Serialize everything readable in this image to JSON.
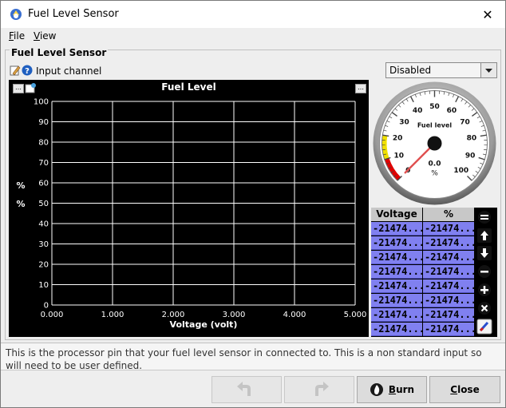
{
  "window": {
    "title": "Fuel Level Sensor",
    "close_glyph": "✕"
  },
  "menu": [
    {
      "accel": "F",
      "rest": "ile"
    },
    {
      "accel": "V",
      "rest": "iew"
    }
  ],
  "group": {
    "title": "Fuel Level Sensor",
    "input_label": "Input channel",
    "input_value": "Disabled"
  },
  "chart_data": {
    "type": "line",
    "title": "Fuel Level",
    "xlabel": "Voltage (volt)",
    "ylabel_lines": [
      "%",
      "%"
    ],
    "xlim": [
      0,
      5
    ],
    "ylim": [
      0,
      100
    ],
    "x_ticks": [
      "0.000",
      "1.000",
      "2.000",
      "3.000",
      "4.000",
      "5.000"
    ],
    "y_ticks": [
      "0",
      "10",
      "20",
      "30",
      "40",
      "50",
      "60",
      "70",
      "80",
      "90",
      "100"
    ],
    "series": [],
    "grid": true
  },
  "gauge": {
    "title": "Fuel level",
    "value": "0.0",
    "unit": "%",
    "min": 0,
    "max": 100,
    "current": 0,
    "ticks": [
      "0",
      "10",
      "20",
      "30",
      "40",
      "50",
      "60",
      "70",
      "80",
      "90",
      "100"
    ],
    "red_range": [
      0,
      10
    ],
    "yellow_range": [
      10,
      20
    ]
  },
  "table": {
    "headers": [
      "Voltage",
      "%"
    ],
    "rows": [
      [
        "-21474...",
        "-21474..."
      ],
      [
        "-21474...",
        "-21474..."
      ],
      [
        "-21474...",
        "-21474..."
      ],
      [
        "-21474...",
        "-21474..."
      ],
      [
        "-21474...",
        "-21474..."
      ],
      [
        "-21474...",
        "-21474..."
      ],
      [
        "-21474...",
        "-21474..."
      ],
      [
        "-21474...",
        "-21474..."
      ]
    ]
  },
  "side_buttons": [
    "equals-icon",
    "arrow-up-icon",
    "arrow-down-icon",
    "minus-icon",
    "plus-icon",
    "clear-icon",
    "pen-icon"
  ],
  "description": "This is the processor pin that your fuel level sensor in connected to. This is a non standard input so will need to be user defined.",
  "footer": {
    "burn_label": "Burn",
    "burn_accel": "B",
    "close_label": "Close",
    "close_accel": "C"
  }
}
